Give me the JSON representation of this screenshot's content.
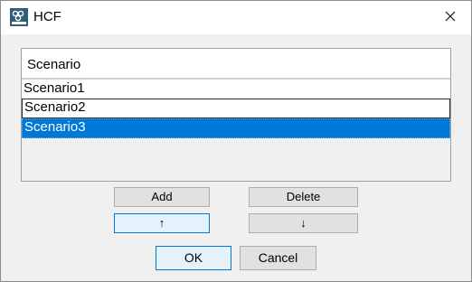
{
  "window": {
    "title": "HCF",
    "app_icon": "hcf-logo-icon",
    "close_icon": "close-icon"
  },
  "list": {
    "header": "Scenario",
    "items": [
      {
        "label": "Scenario1",
        "selected": false
      },
      {
        "label": "Scenario2",
        "selected": false
      },
      {
        "label": "Scenario3",
        "selected": true
      }
    ],
    "selection_color": "#0078d7"
  },
  "buttons": {
    "add": "Add",
    "delete": "Delete",
    "move_up": "↑",
    "move_down": "↓",
    "ok": "OK",
    "cancel": "Cancel"
  }
}
